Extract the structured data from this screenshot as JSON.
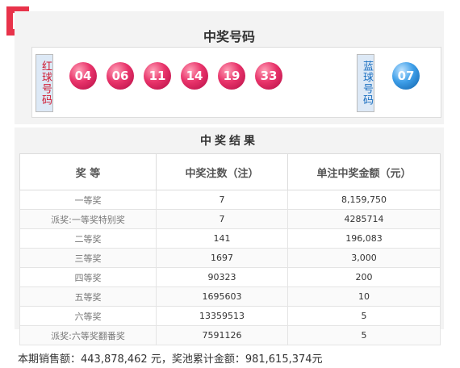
{
  "title": "中奖号码",
  "red_label": "红球号码",
  "blue_label": "蓝球号码",
  "red_balls": [
    "04",
    "06",
    "11",
    "14",
    "19",
    "33"
  ],
  "blue_ball": "07",
  "result_title": "中奖结果",
  "table": {
    "headers": [
      "奖 等",
      "中奖注数（注）",
      "单注中奖金额（元）"
    ],
    "rows": [
      {
        "level": "一等奖",
        "count": "7",
        "amount": "8,159,750"
      },
      {
        "level": "派奖:一等奖特别奖",
        "count": "7",
        "amount": "4285714"
      },
      {
        "level": "二等奖",
        "count": "141",
        "amount": "196,083"
      },
      {
        "level": "三等奖",
        "count": "1697",
        "amount": "3,000"
      },
      {
        "level": "四等奖",
        "count": "90323",
        "amount": "200"
      },
      {
        "level": "五等奖",
        "count": "1695603",
        "amount": "10"
      },
      {
        "level": "六等奖",
        "count": "13359513",
        "amount": "5"
      },
      {
        "level": "派奖:六等奖翻番奖",
        "count": "7591126",
        "amount": "5"
      }
    ]
  },
  "footer": "本期销售额：443,878,462 元，奖池累计金额：981,615,374元",
  "colors": {
    "red": "#e8336a",
    "blue": "#3d9ee8",
    "accent": "#e8334a"
  }
}
